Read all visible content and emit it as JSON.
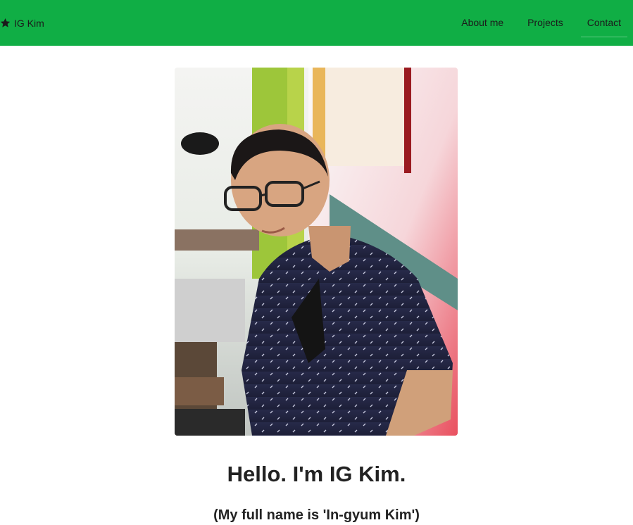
{
  "navbar": {
    "brand_icon": "star-icon",
    "brand_label": "IG Kim",
    "background_color": "#10ae45",
    "links": [
      {
        "label": "About me"
      },
      {
        "label": "Projects"
      },
      {
        "label": "Contact"
      }
    ]
  },
  "hero": {
    "photo_alt": "Portrait photo",
    "headline": "Hello. I'm IG Kim.",
    "subline": "(My full name is 'In-gyum Kim')"
  }
}
